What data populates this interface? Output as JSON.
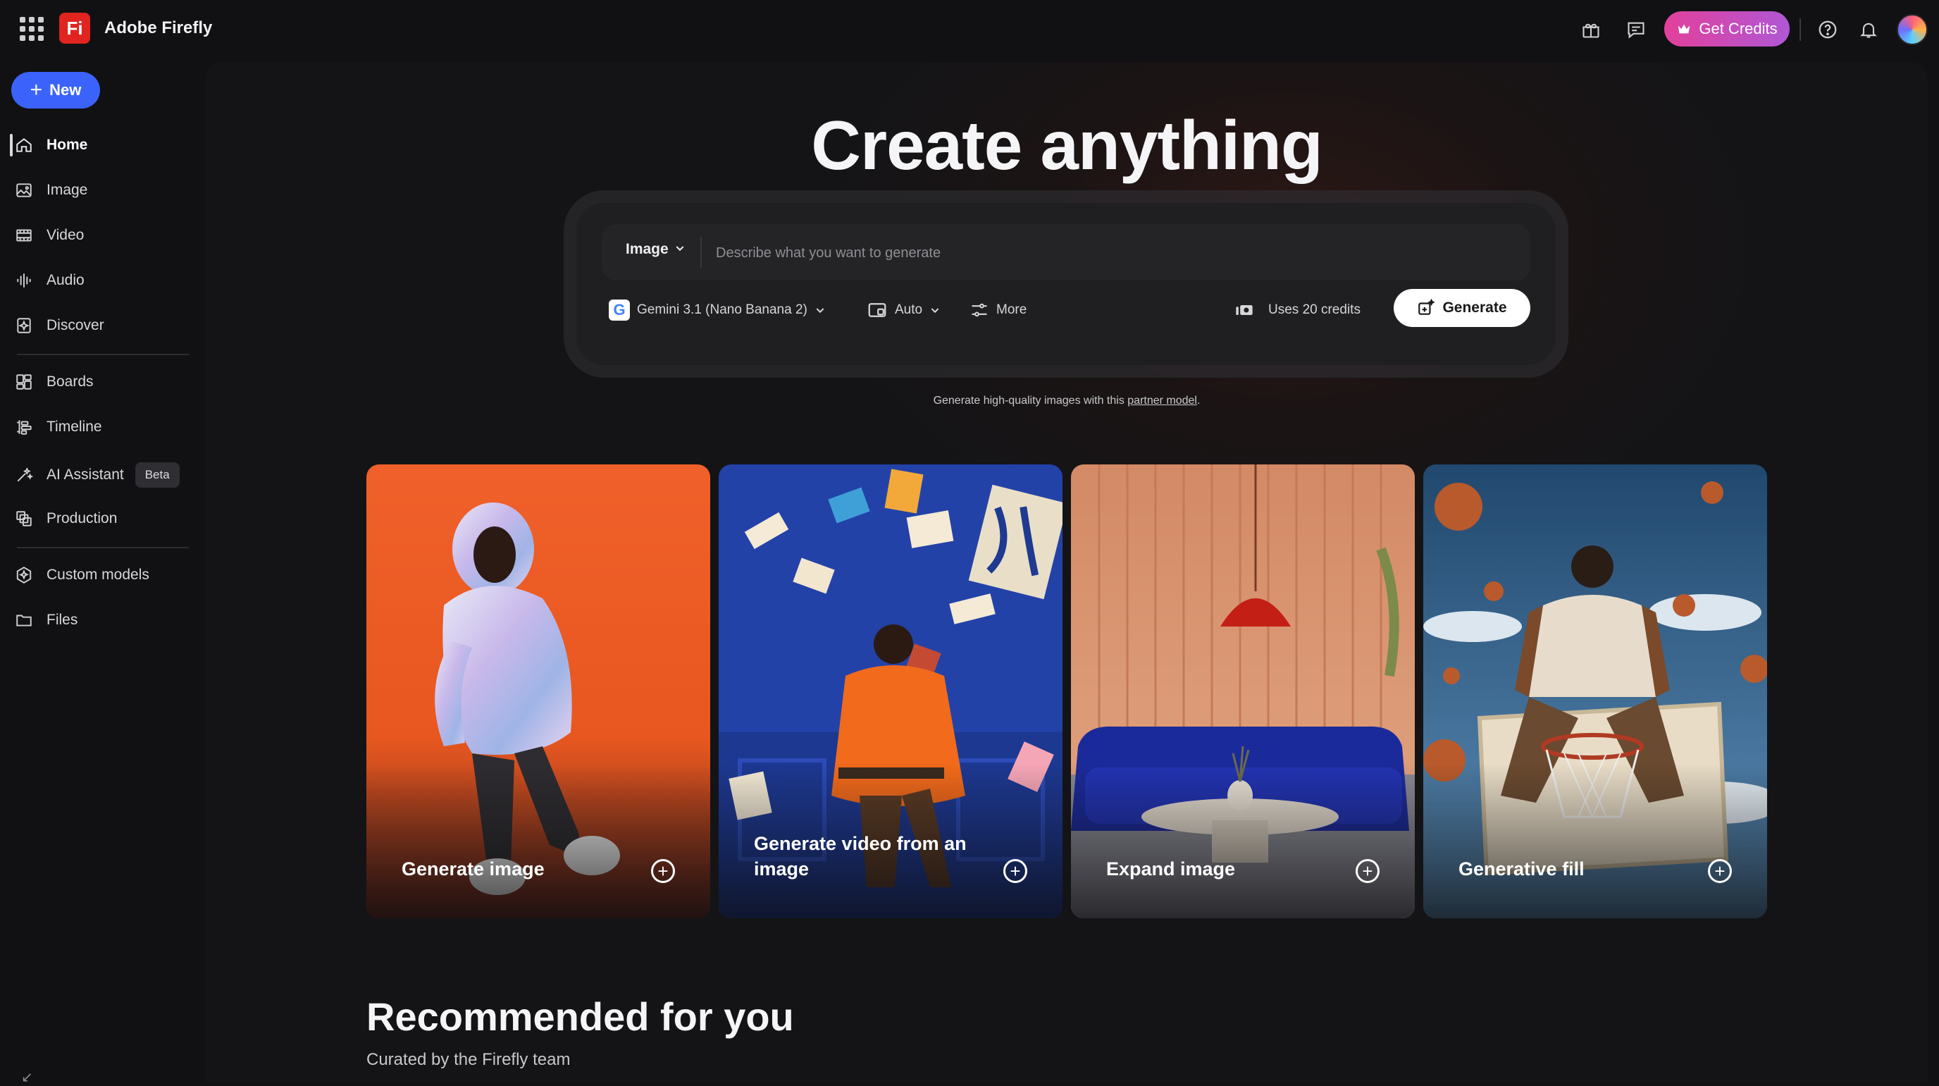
{
  "app": {
    "logo_text": "Fi",
    "name": "Adobe Firefly"
  },
  "topbar": {
    "get_credits": "Get Credits"
  },
  "sidebar": {
    "new_label": "New",
    "items": [
      {
        "label": "Home",
        "icon": "home-icon"
      },
      {
        "label": "Image",
        "icon": "image-icon"
      },
      {
        "label": "Video",
        "icon": "video-icon"
      },
      {
        "label": "Audio",
        "icon": "audio-icon"
      },
      {
        "label": "Discover",
        "icon": "discover-icon"
      },
      {
        "label": "Boards",
        "icon": "boards-icon"
      },
      {
        "label": "Timeline",
        "icon": "timeline-icon"
      },
      {
        "label": "AI Assistant",
        "icon": "ai-assistant-icon",
        "badge": "Beta"
      },
      {
        "label": "Production",
        "icon": "production-icon"
      },
      {
        "label": "Custom models",
        "icon": "custom-models-icon"
      },
      {
        "label": "Files",
        "icon": "folder-icon"
      }
    ]
  },
  "hero": {
    "title": "Create anything"
  },
  "prompt": {
    "type": "Image",
    "placeholder": "Describe what you want to generate",
    "model": "Gemini 3.1 (Nano Banana 2)",
    "aspect": "Auto",
    "more": "More",
    "credits": "Uses 20 credits",
    "generate": "Generate"
  },
  "partner_note": {
    "text": "Generate high-quality images with this",
    "link": "partner model",
    "end": "."
  },
  "cards": [
    {
      "label": "Generate image"
    },
    {
      "label": "Generate video from an image"
    },
    {
      "label": "Expand image"
    },
    {
      "label": "Generative fill"
    }
  ],
  "recommended": {
    "title": "Recommended for you",
    "subtitle": "Curated by the Firefly team"
  }
}
